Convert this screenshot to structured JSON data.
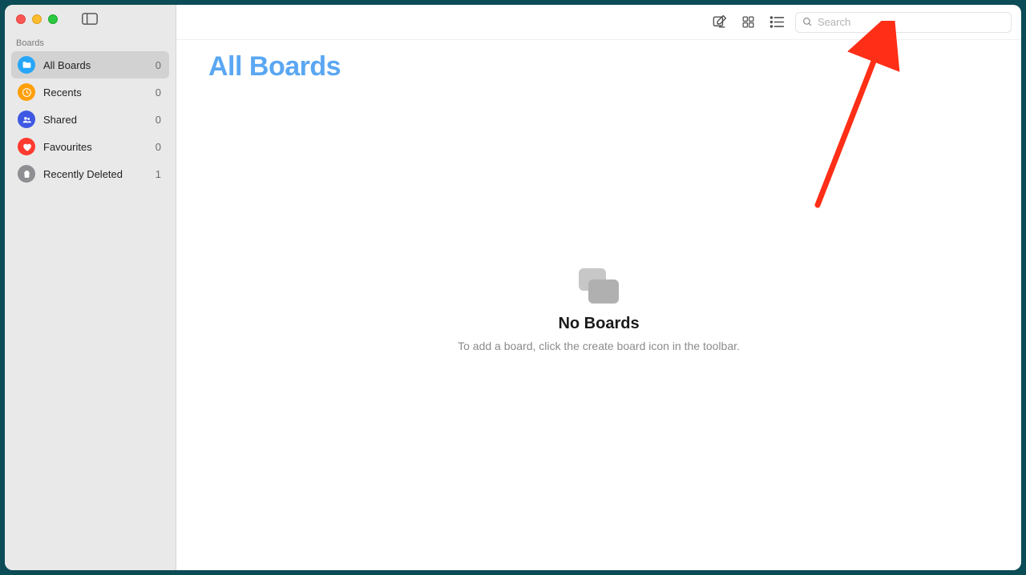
{
  "sidebar": {
    "section_label": "Boards",
    "items": [
      {
        "label": "All Boards",
        "count": "0",
        "icon": "folder-icon",
        "color": "ic-blue",
        "active": true
      },
      {
        "label": "Recents",
        "count": "0",
        "icon": "clock-icon",
        "color": "ic-orange",
        "active": false
      },
      {
        "label": "Shared",
        "count": "0",
        "icon": "people-icon",
        "color": "ic-indigo",
        "active": false
      },
      {
        "label": "Favourites",
        "count": "0",
        "icon": "heart-icon",
        "color": "ic-red",
        "active": false
      },
      {
        "label": "Recently Deleted",
        "count": "1",
        "icon": "trash-icon",
        "color": "ic-gray",
        "active": false
      }
    ]
  },
  "toolbar": {
    "create_board": "Create board",
    "grid_view": "Grid view",
    "list_view": "List view",
    "search_placeholder": "Search"
  },
  "main": {
    "title": "All Boards",
    "empty_title": "No Boards",
    "empty_subtitle": "To add a board, click the create board icon in the toolbar."
  },
  "annotation": {
    "arrow_color": "#ff2e17"
  }
}
